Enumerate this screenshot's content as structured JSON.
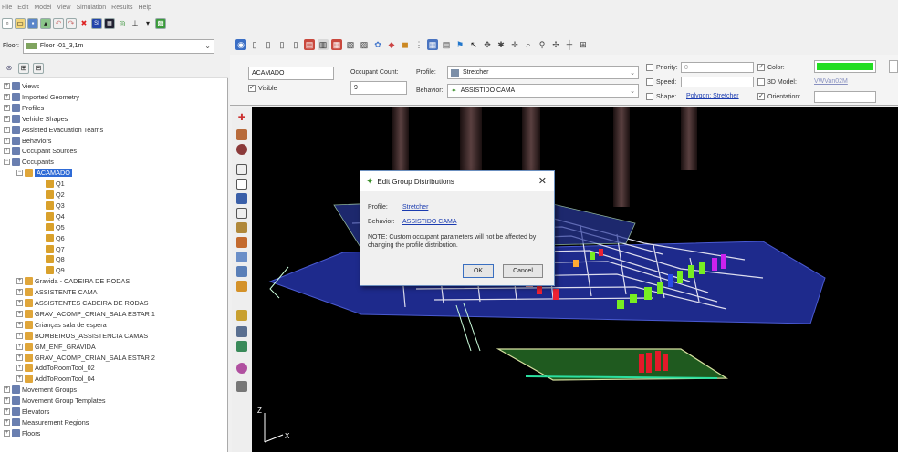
{
  "menu": [
    "File",
    "Edit",
    "Model",
    "View",
    "Simulation",
    "Results",
    "Help"
  ],
  "floor": {
    "label": "Floor:",
    "value": "Floor -01_3,1m"
  },
  "tree": {
    "items": [
      {
        "label": "Views",
        "level": 1
      },
      {
        "label": "Imported Geometry",
        "level": 1
      },
      {
        "label": "Profiles",
        "level": 1
      },
      {
        "label": "Vehicle Shapes",
        "level": 1
      },
      {
        "label": "Assisted Evacuation Teams",
        "level": 1
      },
      {
        "label": "Behaviors",
        "level": 1
      },
      {
        "label": "Occupant Sources",
        "level": 1
      },
      {
        "label": "Occupants",
        "level": 1
      },
      {
        "label": "ACAMADO",
        "level": 2,
        "selected": true
      },
      {
        "label": "Q1",
        "level": 3
      },
      {
        "label": "Q2",
        "level": 3
      },
      {
        "label": "Q3",
        "level": 3
      },
      {
        "label": "Q4",
        "level": 3
      },
      {
        "label": "Q5",
        "level": 3
      },
      {
        "label": "Q6",
        "level": 3
      },
      {
        "label": "Q7",
        "level": 3
      },
      {
        "label": "Q8",
        "level": 3
      },
      {
        "label": "Q9",
        "level": 3
      },
      {
        "label": "Gravida - CADEIRA DE RODAS",
        "level": 2
      },
      {
        "label": "ASSISTENTE CAMA",
        "level": 2
      },
      {
        "label": "ASSISTENTES CADEIRA DE RODAS",
        "level": 2
      },
      {
        "label": "GRAV_ACOMP_CRIAN_SALA ESTAR 1",
        "level": 2
      },
      {
        "label": "Crianças sala de espera",
        "level": 2
      },
      {
        "label": "BOMBEIROS_ASSISTENCIA CAMAS",
        "level": 2
      },
      {
        "label": "GM_ENF_GRAVIDA",
        "level": 2
      },
      {
        "label": "GRAV_ACOMP_CRIAN_SALA ESTAR 2",
        "level": 2
      },
      {
        "label": "AddToRoomTool_02",
        "level": 2
      },
      {
        "label": "AddToRoomTool_04",
        "level": 2
      },
      {
        "label": "Movement Groups",
        "level": 1
      },
      {
        "label": "Movement Group Templates",
        "level": 1
      },
      {
        "label": "Elevators",
        "level": 1
      },
      {
        "label": "Measurement Regions",
        "level": 1
      },
      {
        "label": "Floors",
        "level": 1
      }
    ]
  },
  "props": {
    "name": "ACAMADO",
    "visible_label": "Visible",
    "occupant_count_label": "Occupant Count:",
    "occupant_count": "9",
    "profile_label": "Profile:",
    "profile_value": "Stretcher",
    "behavior_label": "Behavior:",
    "behavior_value": "ASSISTIDO CAMA",
    "priority_label": "Priority:",
    "priority_value": "0",
    "speed_label": "Speed:",
    "shape_label": "Shape:",
    "shape_value": "Polygon: Stretcher",
    "color_label": "Color:",
    "color_value": "#22dd22",
    "models_label": "3D Model:",
    "models_value": "VWVan02M",
    "orientation_label": "Orientation:"
  },
  "dialog": {
    "title": "Edit Group Distributions",
    "profile_label": "Profile:",
    "profile_link": "Stretcher",
    "behavior_label": "Behavior:",
    "behavior_link": "ASSISTIDO CAMA",
    "note": "NOTE: Custom occupant parameters will not be affected by changing the profile distribution.",
    "ok": "OK",
    "cancel": "Cancel"
  },
  "axes": {
    "z": "Z",
    "x": "X"
  }
}
